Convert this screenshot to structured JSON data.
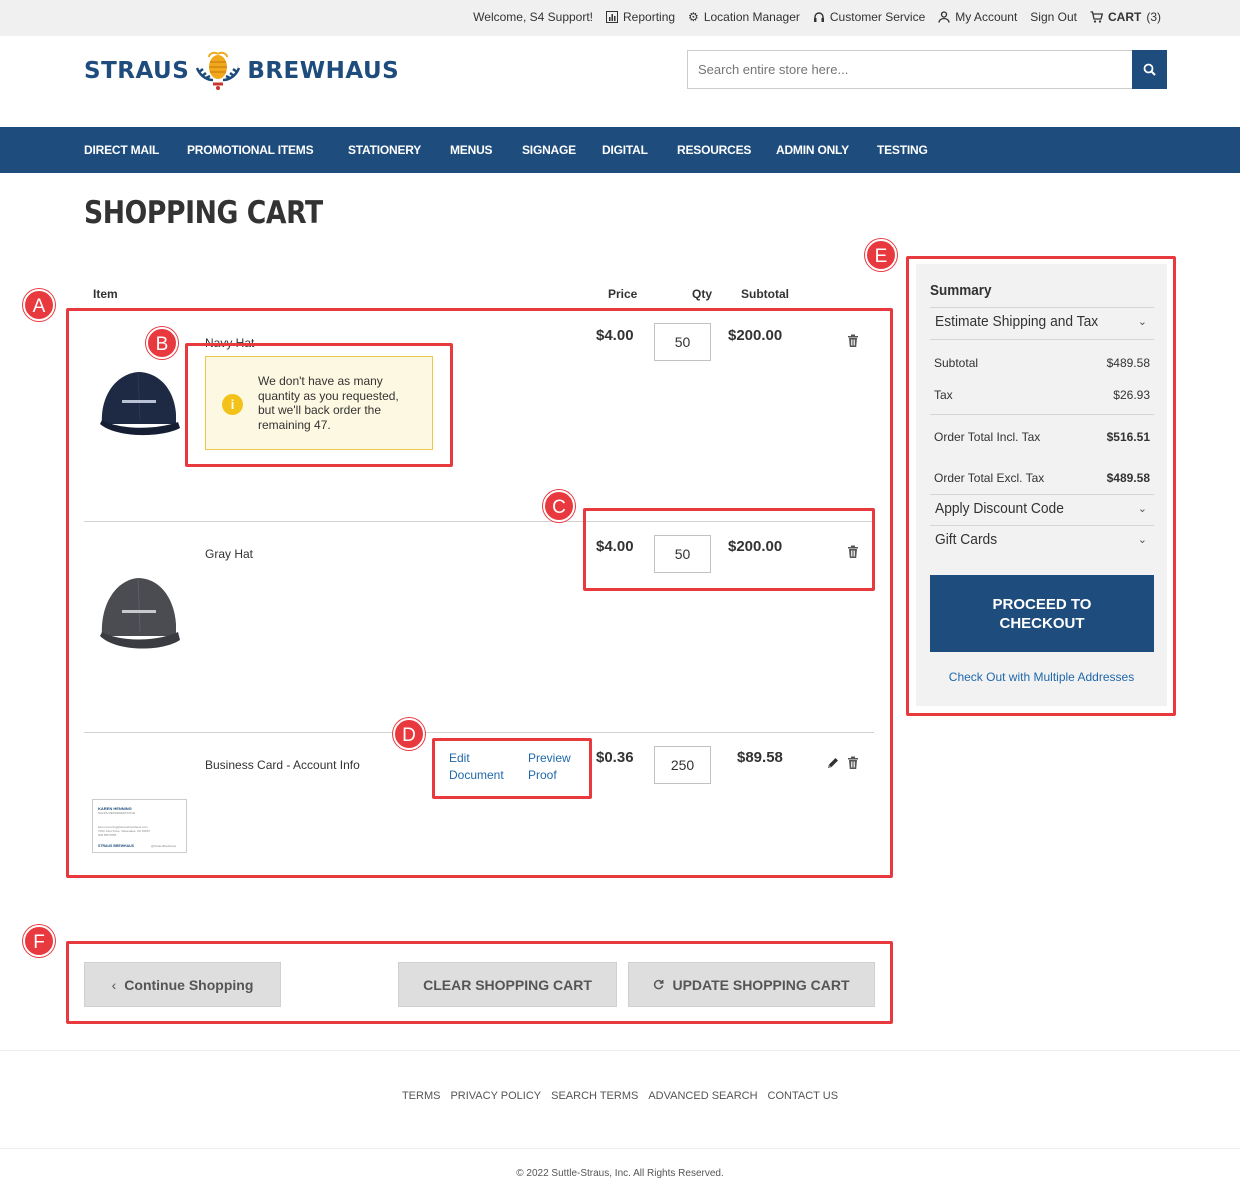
{
  "topbar": {
    "welcome": "Welcome, S4 Support!",
    "reporting": "Reporting",
    "location_manager": "Location Manager",
    "customer_service": "Customer Service",
    "my_account": "My Account",
    "sign_out": "Sign Out",
    "cart_label": "CART",
    "cart_count": "(3)"
  },
  "brand": {
    "left": "STRAUS",
    "right": "BREWHAUS"
  },
  "search": {
    "placeholder": "Search entire store here..."
  },
  "nav": [
    "DIRECT MAIL",
    "PROMOTIONAL ITEMS",
    "STATIONERY",
    "MENUS",
    "SIGNAGE",
    "DIGITAL",
    "RESOURCES",
    "ADMIN ONLY",
    "TESTING"
  ],
  "page_title": "SHOPPING CART",
  "table": {
    "headers": {
      "item": "Item",
      "price": "Price",
      "qty": "Qty",
      "subtotal": "Subtotal"
    },
    "rows": [
      {
        "name": "Navy Hat",
        "price": "$4.00",
        "qty": "50",
        "subtotal": "$200.00"
      },
      {
        "name": "Gray Hat",
        "price": "$4.00",
        "qty": "50",
        "subtotal": "$200.00"
      },
      {
        "name": "Business Card - Account Info",
        "price": "$0.36",
        "qty": "250",
        "subtotal": "$89.58",
        "edit_link": "Edit Document",
        "preview_link": "Preview Proof"
      }
    ],
    "warning": "We don't have as many quantity as you requested, but we'll back order the remaining 47."
  },
  "summary": {
    "title": "Summary",
    "estimate": "Estimate Shipping and Tax",
    "subtotal_label": "Subtotal",
    "subtotal_value": "$489.58",
    "tax_label": "Tax",
    "tax_value": "$26.93",
    "incl_label": "Order Total Incl. Tax",
    "incl_value": "$516.51",
    "excl_label": "Order Total Excl. Tax",
    "excl_value": "$489.58",
    "discount": "Apply Discount Code",
    "gift": "Gift Cards",
    "checkout": "PROCEED TO CHECKOUT",
    "multi": "Check Out with Multiple Addresses"
  },
  "actions": {
    "continue": "Continue Shopping",
    "clear": "CLEAR SHOPPING CART",
    "update": "UPDATE SHOPPING CART"
  },
  "footer": {
    "links": [
      "TERMS",
      "PRIVACY POLICY",
      "SEARCH TERMS",
      "ADVANCED SEARCH",
      "CONTACT US"
    ],
    "copyright": "© 2022 Suttle-Straus, Inc. All Rights Reserved."
  },
  "card_thumb": {
    "name": "KAREN HENNING",
    "title": "SALES REPRESENTATIVE",
    "email": "karen.henning@strausbrewhaus.com",
    "address": "7000 Joint Drive, Waunakee, WI 53597",
    "phone": "608.555.5555",
    "brand": "STRAUS BREWHAUS",
    "handle": "@StrausBrewhaus"
  },
  "annotations": [
    "A",
    "B",
    "C",
    "D",
    "E",
    "F"
  ],
  "colors": {
    "brand_blue": "#1e4c7c",
    "link_blue": "#1f68ab",
    "annotation_red": "#e8393f",
    "warning_bg": "#fdf8e1"
  }
}
